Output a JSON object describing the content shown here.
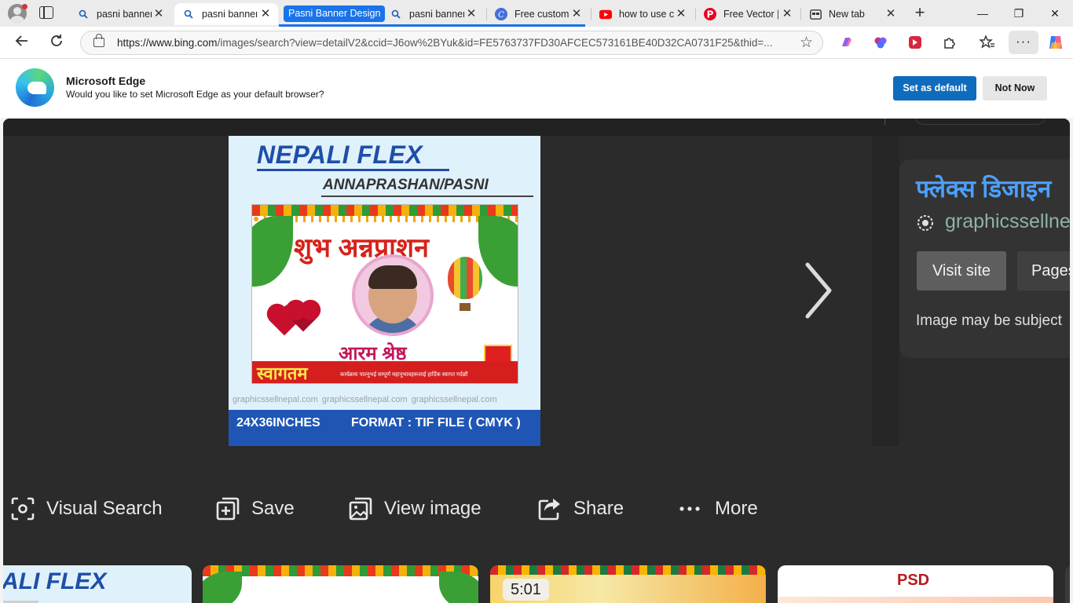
{
  "tabs": [
    {
      "title": "pasni banner",
      "icon": "search-icon"
    },
    {
      "title": "pasni banner",
      "icon": "search-icon",
      "active": true
    },
    {
      "title": "pasni banner",
      "icon": "search-icon"
    },
    {
      "title": "Free customiz",
      "icon": "canva-icon"
    },
    {
      "title": "how to use ca",
      "icon": "youtube-icon"
    },
    {
      "title": "Free Vector |",
      "icon": "pinterest-icon"
    },
    {
      "title": "New tab",
      "icon": "newtab-icon"
    }
  ],
  "tab_group": {
    "label": "Pasni Banner Design",
    "color": "#1a73e8"
  },
  "window_controls": {
    "minimize": "—",
    "restore": "❐",
    "close": "✕"
  },
  "address_bar": {
    "url_host": "https://www.bing.com",
    "url_path": "/images/search?view=detailV2&ccid=J6ow%2BYuk&id=FE5763737FD30AFCEC573161BE40D32CA0731F25&thid=..."
  },
  "default_prompt": {
    "title": "Microsoft Edge",
    "message": "Would you like to set Microsoft Edge as your default browser?",
    "primary_button": "Set as default",
    "secondary_button": "Not Now",
    "accent": "#0f6cbd"
  },
  "image_preview": {
    "title": "NEPALI FLEX",
    "subtitle": "ANNAPRASHAN/PASNI",
    "heading_nepali": "शुभ अन्नप्राशन",
    "name_nepali": "आरम श्रेष्ठ",
    "welcome_nepali": "स्वागतम",
    "welcome_small": "कार्यक्रमा पाल्नुभई सम्पूर्ण महानुभावहरूलाई हार्दिक स्वागत गर्दछौं",
    "watermark": "graphicssellnepal.com   graphicssellnepal.com   graphicssellnepal.com",
    "size_label": "24X36INCHES",
    "format_label": "FORMAT : TIF FILE ( CMYK )"
  },
  "info_panel": {
    "title": "फ्लेक्स डिजाइन",
    "domain": "graphicssellne",
    "visit_button": "Visit site",
    "pages_button": "Pages",
    "note": "Image may be subject"
  },
  "actions": [
    {
      "label": "Visual Search",
      "icon": "visual-search-icon"
    },
    {
      "label": "Save",
      "icon": "save-icon"
    },
    {
      "label": "View image",
      "icon": "view-image-icon"
    },
    {
      "label": "Share",
      "icon": "share-icon"
    },
    {
      "label": "More",
      "icon": "more-icon"
    }
  ],
  "thumbnails": [
    {
      "text": "ALI FLEX"
    },
    {
      "text": ""
    },
    {
      "duration": "5:01"
    },
    {
      "text": "PSD"
    }
  ]
}
